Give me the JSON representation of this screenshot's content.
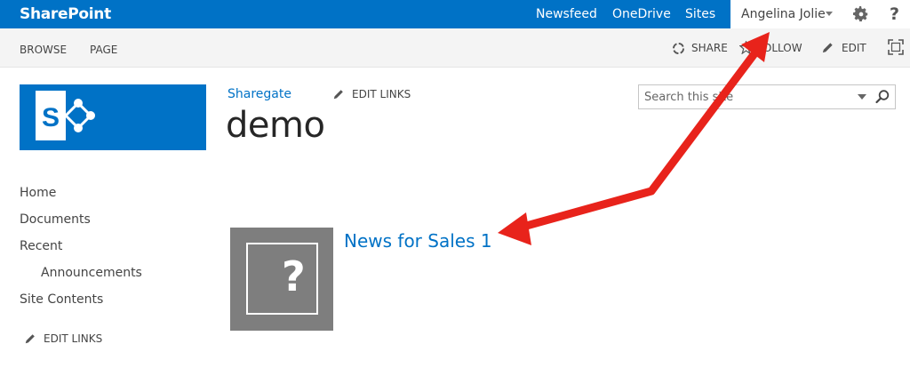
{
  "suitebar": {
    "brand": "SharePoint",
    "links": [
      "Newsfeed",
      "OneDrive",
      "Sites"
    ],
    "user_name": "Angelina Jolie",
    "help_glyph": "?",
    "accent_color": "#0072c6"
  },
  "ribbon": {
    "tabs": [
      "BROWSE",
      "PAGE"
    ],
    "share_label": "SHARE",
    "follow_label": "FOLLOW",
    "edit_label": "EDIT",
    "icons": [
      "share-icon",
      "follow-star-icon",
      "edit-pencil-icon",
      "focus-on-content-icon"
    ]
  },
  "header": {
    "top_link": "Sharegate",
    "edit_links_label": "EDIT LINKS",
    "site_title": "demo",
    "logo_letter": "S"
  },
  "search": {
    "placeholder": "Search this site"
  },
  "leftnav": {
    "items": [
      "Home",
      "Documents",
      "Recent",
      "Announcements",
      "Site Contents"
    ],
    "edit_links_label": "EDIT LINKS"
  },
  "content": {
    "news_title": "News for Sales 1",
    "thumbnail_glyph": "?"
  },
  "annotation": {
    "arrow_color": "#e8231b"
  }
}
